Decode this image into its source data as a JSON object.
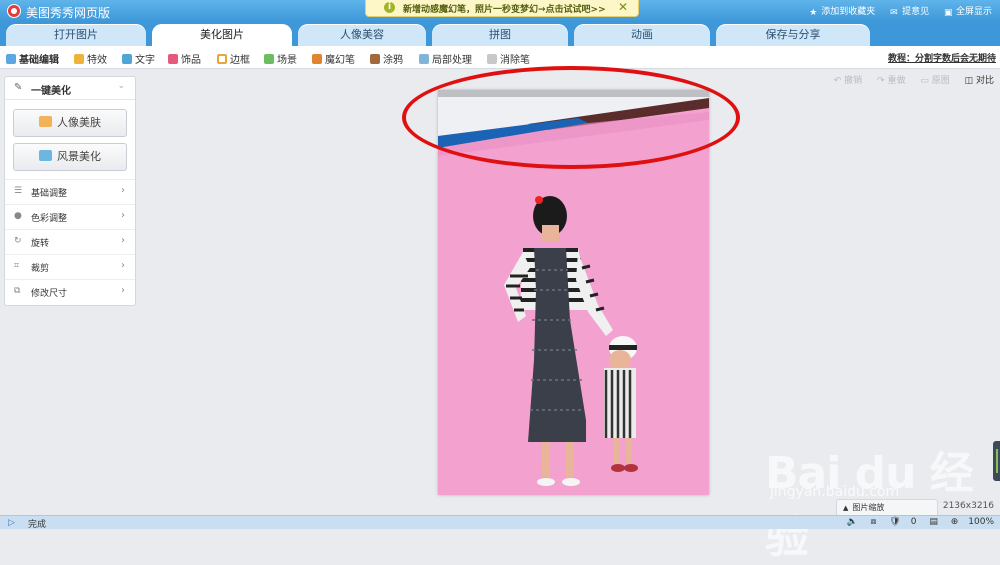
{
  "app": {
    "title": "美图秀秀网页版"
  },
  "notice": {
    "text": "新增动感魔幻笔，照片一秒变梦幻→点击试试吧>>",
    "close": "✕",
    "icon": "i"
  },
  "top_links": {
    "favorite": "添加到收藏夹",
    "feedback": "提意见",
    "fullscreen": "全屏显示"
  },
  "tabs": [
    {
      "label": "打开图片"
    },
    {
      "label": "美化图片"
    },
    {
      "label": "人像美容"
    },
    {
      "label": "拼图"
    },
    {
      "label": "动画"
    },
    {
      "label": "保存与分享"
    }
  ],
  "active_tab": "美化图片",
  "toolbar": {
    "items": [
      {
        "label": "基础编辑",
        "icon": "basic-edit-icon"
      },
      {
        "label": "特效",
        "icon": "effects-icon"
      },
      {
        "label": "文字",
        "icon": "text-icon"
      },
      {
        "label": "饰品",
        "icon": "accessory-icon"
      },
      {
        "label": "边框",
        "icon": "frame-icon"
      },
      {
        "label": "场景",
        "icon": "scene-icon"
      },
      {
        "label": "魔幻笔",
        "icon": "magic-pen-icon"
      },
      {
        "label": "涂鸦",
        "icon": "doodle-icon"
      },
      {
        "label": "局部处理",
        "icon": "local-process-icon"
      },
      {
        "label": "消除笔",
        "icon": "eraser-pen-icon"
      }
    ],
    "tutorial": "教程：分割字数后会无期待"
  },
  "left_panel": {
    "header": "一键美化",
    "buttons": {
      "portrait": "人像美肤",
      "landscape": "风景美化"
    },
    "items": [
      {
        "label": "基础调整"
      },
      {
        "label": "色彩调整"
      },
      {
        "label": "旋转"
      },
      {
        "label": "裁剪"
      },
      {
        "label": "修改尺寸"
      }
    ]
  },
  "actions": {
    "undo": "撤销",
    "redo": "重做",
    "original": "原图",
    "compare": "对比"
  },
  "photo": {
    "dimensions": "2136x3216"
  },
  "zoom_panel": {
    "label": "图片缩放"
  },
  "watermark": {
    "brand": "Bai du 经验",
    "url": "jingyan.baidu.com"
  },
  "status": {
    "text": "完成",
    "count_a": "0",
    "zoom": "100%"
  },
  "colors": {
    "accent": "#3d97d8",
    "annotation": "#e01010",
    "photo_bg": "#f3a2d0"
  }
}
